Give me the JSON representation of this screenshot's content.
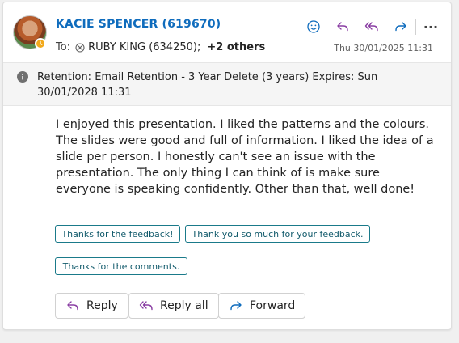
{
  "sender": {
    "name": "KACIE SPENCER (619670)",
    "presence": "away"
  },
  "header": {
    "to_label": "To:",
    "recipient": "RUBY KING (634250);",
    "others": "+2 others",
    "date": "Thu 30/01/2025 11:31",
    "actions": [
      "emoji-icon",
      "reply-icon",
      "reply-all-icon",
      "forward-icon",
      "more-icon"
    ]
  },
  "retention": {
    "text": "Retention: Email Retention - 3 Year Delete (3 years) Expires: Sun 30/01/2028 11:31"
  },
  "message": {
    "body": "I enjoyed this presentation. I liked the patterns and the colours. The slides were good and full of information. I liked the idea of a slide per person. I honestly can't see an issue with the presentation. The only thing I can think of is make sure everyone is speaking confidently. Other than that, well done!"
  },
  "suggestions": [
    "Thanks for the feedback!",
    "Thank you so much for your feedback.",
    "Thanks for the comments."
  ],
  "reply_buttons": {
    "reply": "Reply",
    "reply_all": "Reply all",
    "forward": "Forward"
  },
  "colors": {
    "accent": "#0f6cbd",
    "reply_all_icon": "#8a3ea3",
    "suggestion_border": "#1a7a8a",
    "presence_away": "#f2a91b"
  }
}
